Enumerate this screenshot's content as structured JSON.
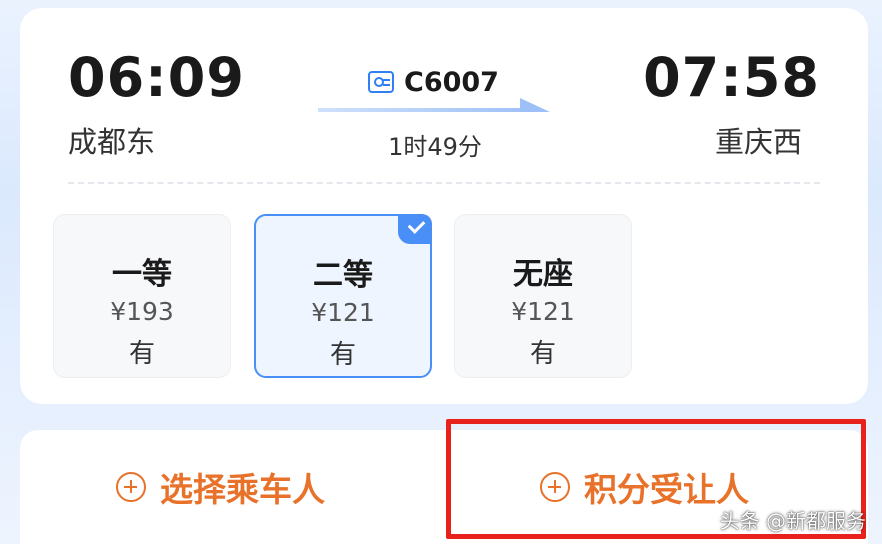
{
  "trip": {
    "departure_time": "06:09",
    "departure_station": "成都东",
    "arrival_time": "07:58",
    "arrival_station": "重庆西",
    "train_number": "C6007",
    "duration": "1时49分"
  },
  "seats": [
    {
      "class": "一等",
      "price": "¥193",
      "availability": "有",
      "selected": false
    },
    {
      "class": "二等",
      "price": "¥121",
      "availability": "有",
      "selected": true
    },
    {
      "class": "无座",
      "price": "¥121",
      "availability": "有",
      "selected": false
    }
  ],
  "actions": {
    "select_passenger": "选择乘车人",
    "points_transferee": "积分受让人"
  },
  "watermark": "头条 @新都服务",
  "colors": {
    "accent_blue": "#4a8ff7",
    "action_orange": "#e8722a",
    "highlight_red": "#e8211c"
  },
  "icons": {
    "train": "id-card-icon",
    "arrow": "right-arrow-icon",
    "selected": "check-icon",
    "add": "plus-circle-icon"
  }
}
